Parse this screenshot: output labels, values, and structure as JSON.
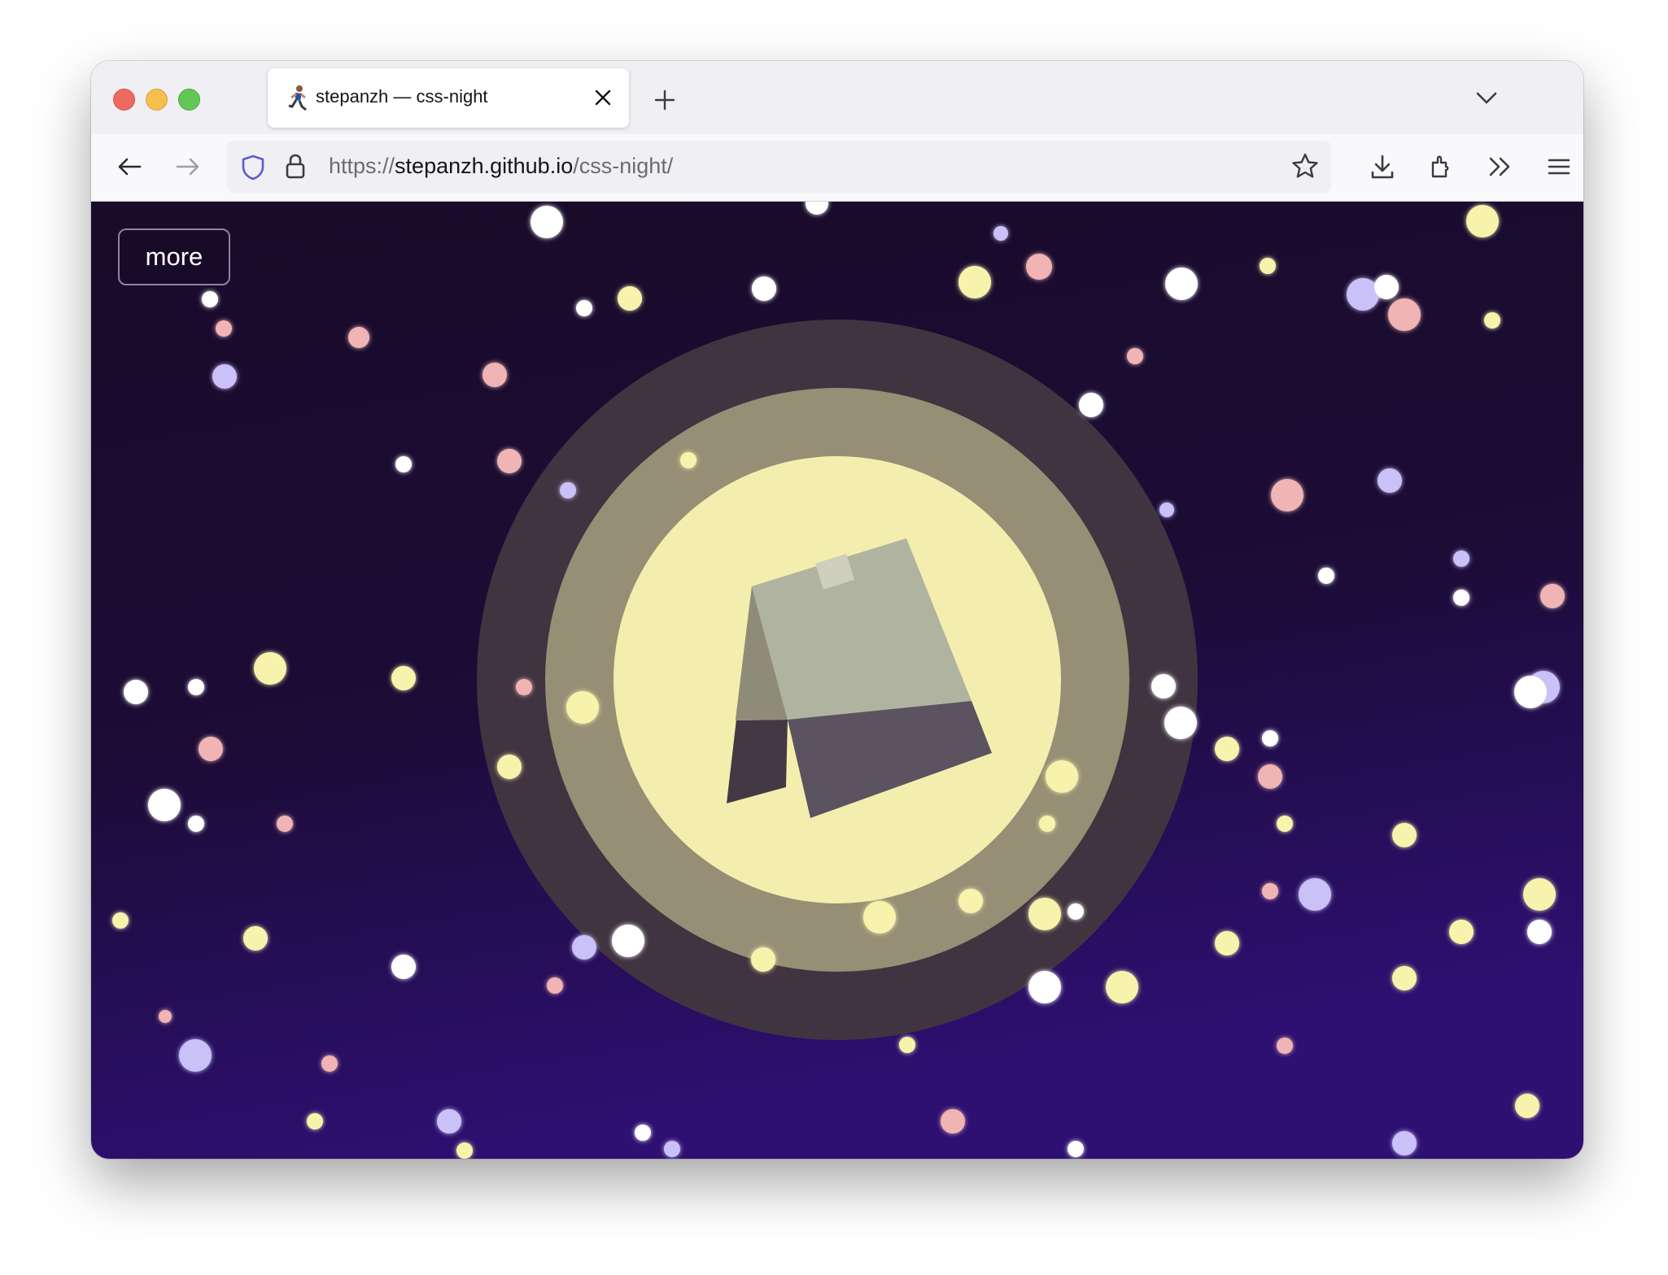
{
  "window": {
    "controls": [
      "close",
      "minimize",
      "maximize"
    ]
  },
  "tab": {
    "title": "stepanzh — css-night",
    "favicon": "runner-emoji-icon"
  },
  "navbar": {
    "url_scheme": "https://",
    "url_host": "stepanzh.github.io",
    "url_path": "/css-night/",
    "icons": [
      "back-arrow-icon",
      "forward-arrow-icon",
      "shield-icon",
      "lock-icon",
      "star-icon",
      "download-icon",
      "extensions-icon",
      "overflow-chevrons-icon",
      "hamburger-menu-icon"
    ]
  },
  "page": {
    "more_label": "more",
    "colors": {
      "sky_top": "#190b29",
      "sky_bottom": "#2e0f72",
      "halo_outer": "#413441",
      "halo_middle": "#968f75",
      "moon": "#f3eeae",
      "teabag": "#b1b3a1",
      "teabag_shadow": "#5b5360",
      "star_white": "#ffffff",
      "star_yellow": "#f7f3ad",
      "star_pink": "#f0b4b4",
      "star_violet": "#c9c1f8"
    }
  }
}
